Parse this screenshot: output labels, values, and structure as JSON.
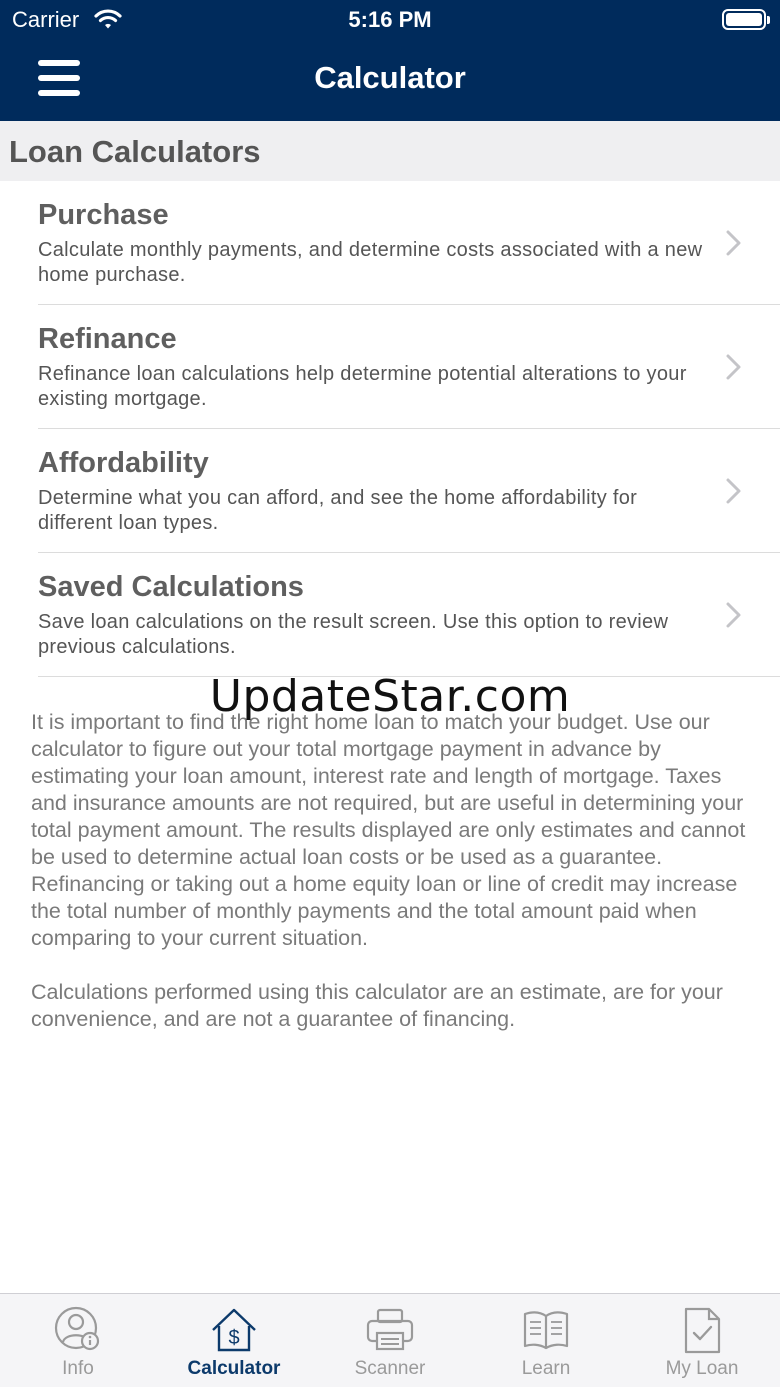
{
  "status_bar": {
    "carrier": "Carrier",
    "time": "5:16 PM"
  },
  "nav": {
    "title": "Calculator",
    "menu_icon": "hamburger-icon"
  },
  "section": {
    "title": "Loan Calculators"
  },
  "calculators": [
    {
      "title": "Purchase",
      "description": "Calculate monthly payments, and determine costs associated with a new home purchase."
    },
    {
      "title": "Refinance",
      "description": "Refinance loan calculations help determine potential alterations to your existing mortgage."
    },
    {
      "title": "Affordability",
      "description": "Determine what you can afford, and see the home affordability for different loan types."
    },
    {
      "title": "Saved Calculations",
      "description": "Save loan calculations on the result screen. Use this option to review previous calculations."
    }
  ],
  "disclaimer": {
    "paragraph1": "It is important to find the right home loan to match your budget. Use our calculator to figure out your total mortgage payment in advance by estimating your loan amount, interest rate and length of mortgage. Taxes and insurance amounts are not required, but are useful in determining your total payment amount.  The results displayed are only estimates and cannot be used to determine actual loan costs or be used as a guarantee. Refinancing or taking out a home equity loan or line of credit may increase the total number of monthly payments and the total amount paid when comparing to your current situation.",
    "paragraph2": "Calculations performed using this calculator are an estimate, are for your convenience, and are not a guarantee of financing."
  },
  "watermark": "UpdateStar.com",
  "tabs": [
    {
      "label": "Info",
      "icon": "info-person-icon",
      "active": false
    },
    {
      "label": "Calculator",
      "icon": "house-dollar-icon",
      "active": true
    },
    {
      "label": "Scanner",
      "icon": "printer-icon",
      "active": false
    },
    {
      "label": "Learn",
      "icon": "open-book-icon",
      "active": false
    },
    {
      "label": "My Loan",
      "icon": "document-check-icon",
      "active": false
    }
  ],
  "colors": {
    "nav_background": "#002b5c",
    "active_tab": "#0c3a6b",
    "inactive_tab": "#9a9a9a",
    "section_header_bg": "#efeff1"
  }
}
